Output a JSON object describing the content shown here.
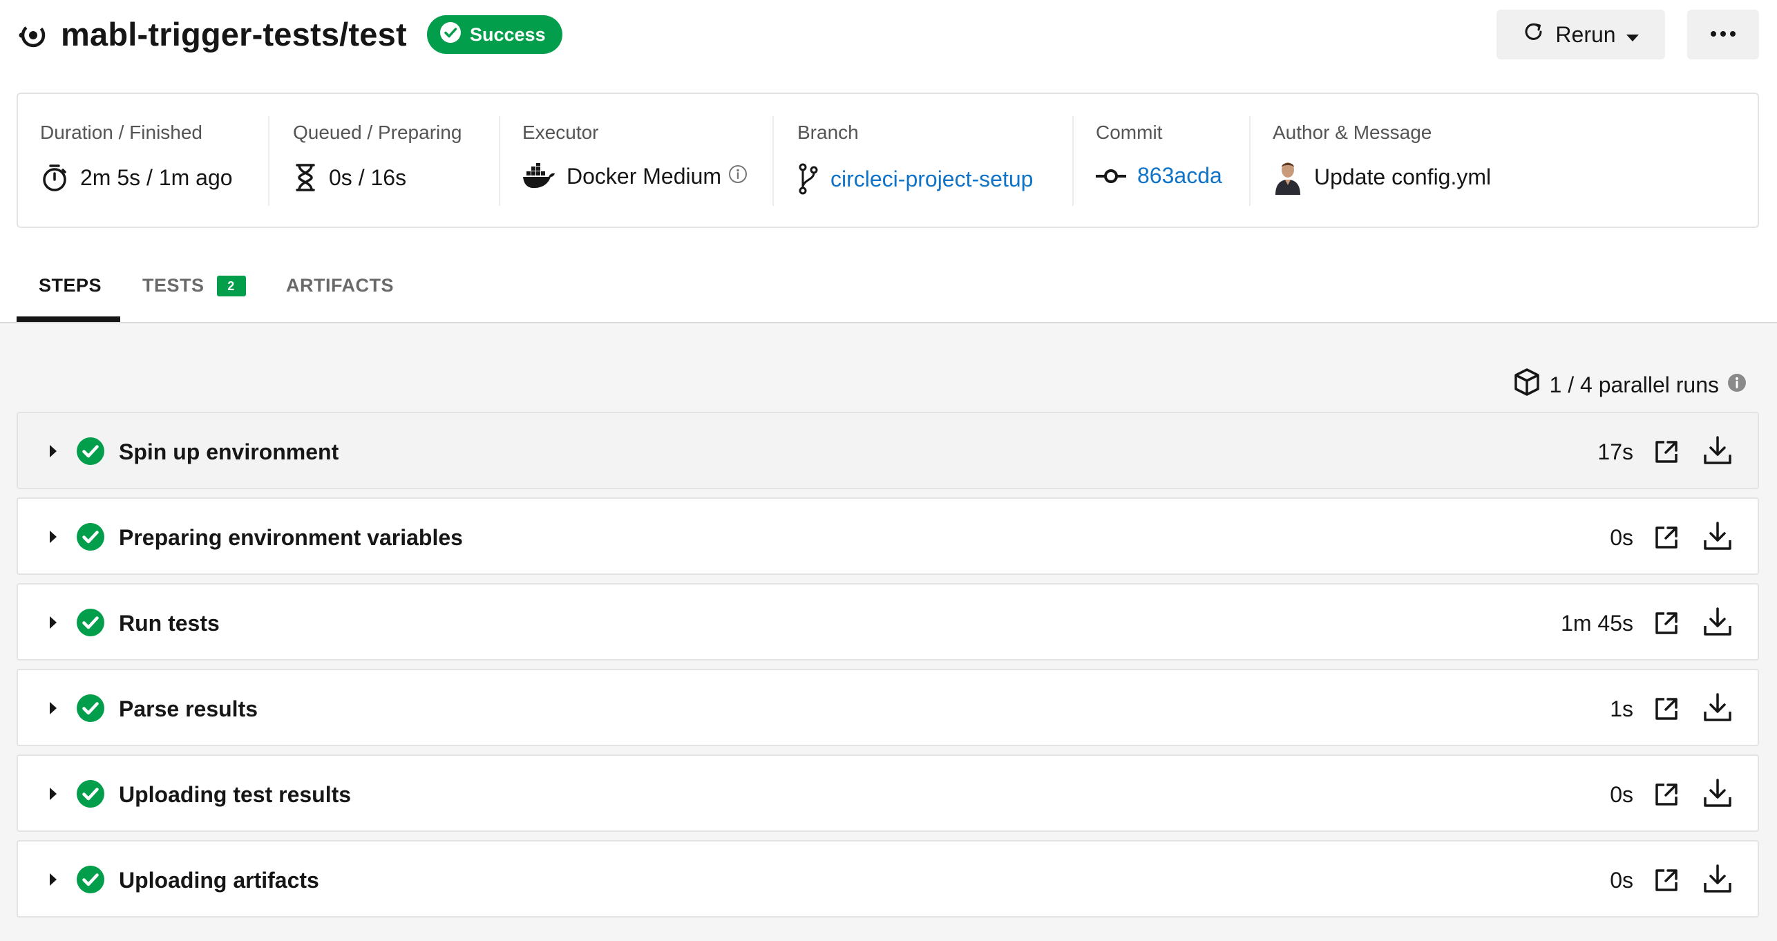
{
  "header": {
    "title": "mabl-trigger-tests/test",
    "status": "Success",
    "rerun_label": "Rerun"
  },
  "info": {
    "duration": {
      "label": "Duration / Finished",
      "value": "2m 5s / 1m ago"
    },
    "queued": {
      "label": "Queued / Preparing",
      "value": "0s / 16s"
    },
    "executor": {
      "label": "Executor",
      "value": "Docker Medium"
    },
    "branch": {
      "label": "Branch",
      "value": "circleci-project-setup"
    },
    "commit": {
      "label": "Commit",
      "value": "863acda"
    },
    "author": {
      "label": "Author & Message",
      "value": "Update config.yml"
    }
  },
  "tabs": [
    {
      "label": "STEPS",
      "active": true
    },
    {
      "label": "TESTS",
      "badge": "2"
    },
    {
      "label": "ARTIFACTS"
    }
  ],
  "parallel": {
    "label": "1 / 4 parallel runs"
  },
  "steps": [
    {
      "name": "Spin up environment",
      "duration": "17s"
    },
    {
      "name": "Preparing environment variables",
      "duration": "0s"
    },
    {
      "name": "Run tests",
      "duration": "1m 45s"
    },
    {
      "name": "Parse results",
      "duration": "1s"
    },
    {
      "name": "Uploading test results",
      "duration": "0s"
    },
    {
      "name": "Uploading artifacts",
      "duration": "0s"
    }
  ],
  "colors": {
    "success_green": "#039e4b",
    "link_blue": "#0f73c8",
    "text": "#161616",
    "muted": "#555555",
    "panel_border": "#e3e3e3",
    "steps_bg": "#f5f5f5"
  },
  "icons": {
    "job": "job-icon",
    "status": "check-circle-icon",
    "rerun": "refresh-icon",
    "more": "ellipsis-icon",
    "duration": "stopwatch-icon",
    "queued": "hourglass-icon",
    "executor": "docker-icon",
    "branch": "git-branch-icon",
    "commit": "git-commit-icon",
    "author": "avatar",
    "parallel": "cube-icon"
  }
}
